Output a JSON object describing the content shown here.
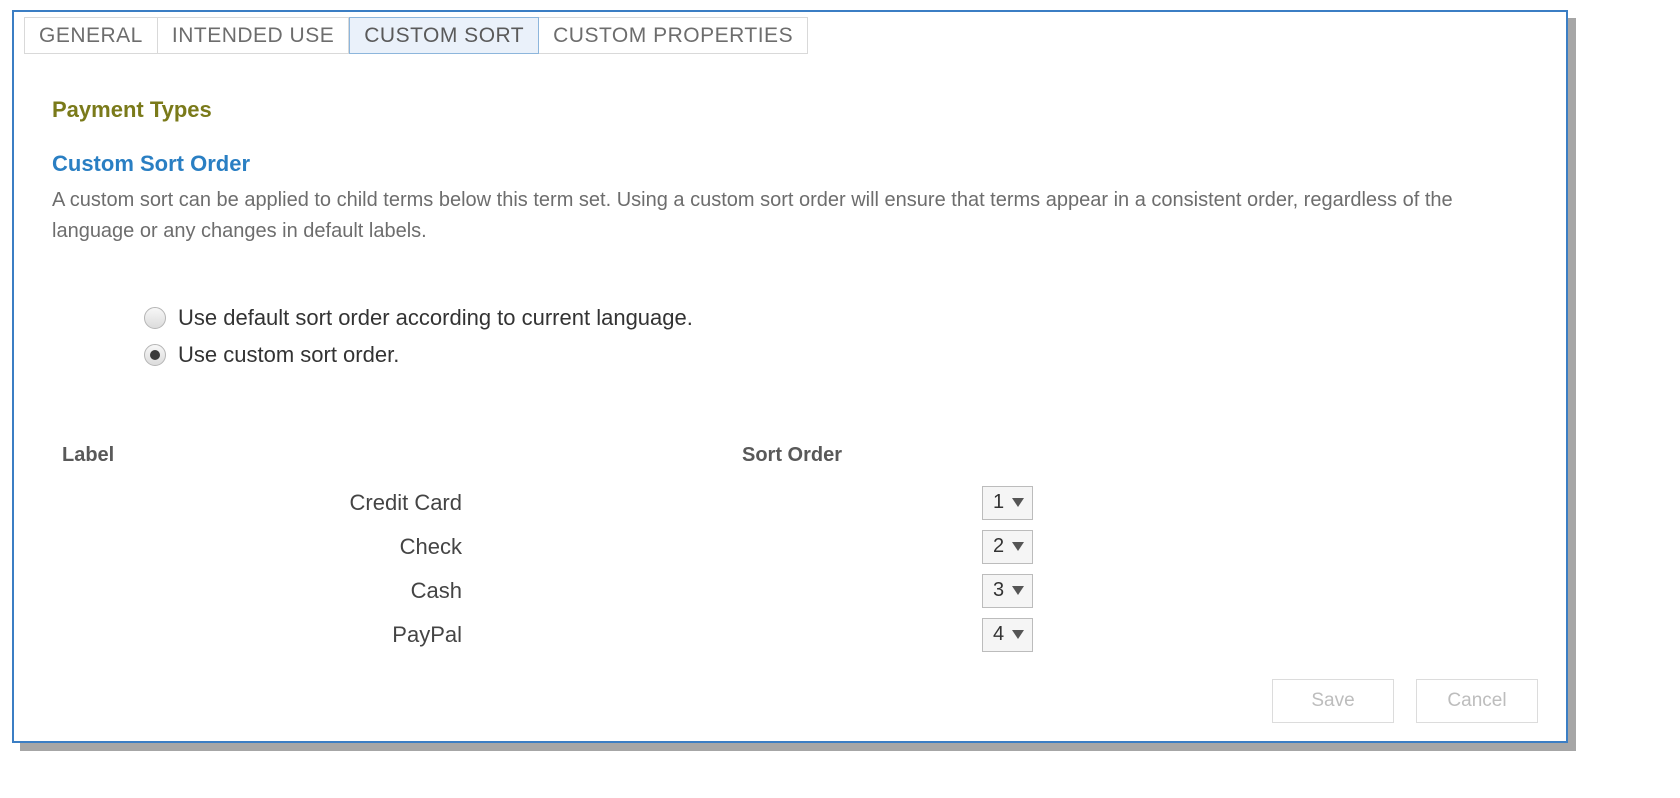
{
  "tabs": [
    {
      "label": "GENERAL",
      "active": false
    },
    {
      "label": "INTENDED USE",
      "active": false
    },
    {
      "label": "CUSTOM SORT",
      "active": true
    },
    {
      "label": "CUSTOM PROPERTIES",
      "active": false
    }
  ],
  "page_title": "Payment Types",
  "section_title": "Custom Sort Order",
  "section_desc": "A custom sort can be applied to child terms below this term set. Using a custom sort order will ensure that terms appear in a consistent order, regardless of the language or any changes in default labels.",
  "radios": {
    "default_label": "Use default sort order according to current language.",
    "custom_label": "Use custom sort order.",
    "selected": "custom"
  },
  "table": {
    "header_label": "Label",
    "header_order": "Sort Order",
    "rows": [
      {
        "label": "Credit Card",
        "order": "1"
      },
      {
        "label": "Check",
        "order": "2"
      },
      {
        "label": "Cash",
        "order": "3"
      },
      {
        "label": "PayPal",
        "order": "4"
      }
    ]
  },
  "buttons": {
    "save": "Save",
    "cancel": "Cancel"
  }
}
